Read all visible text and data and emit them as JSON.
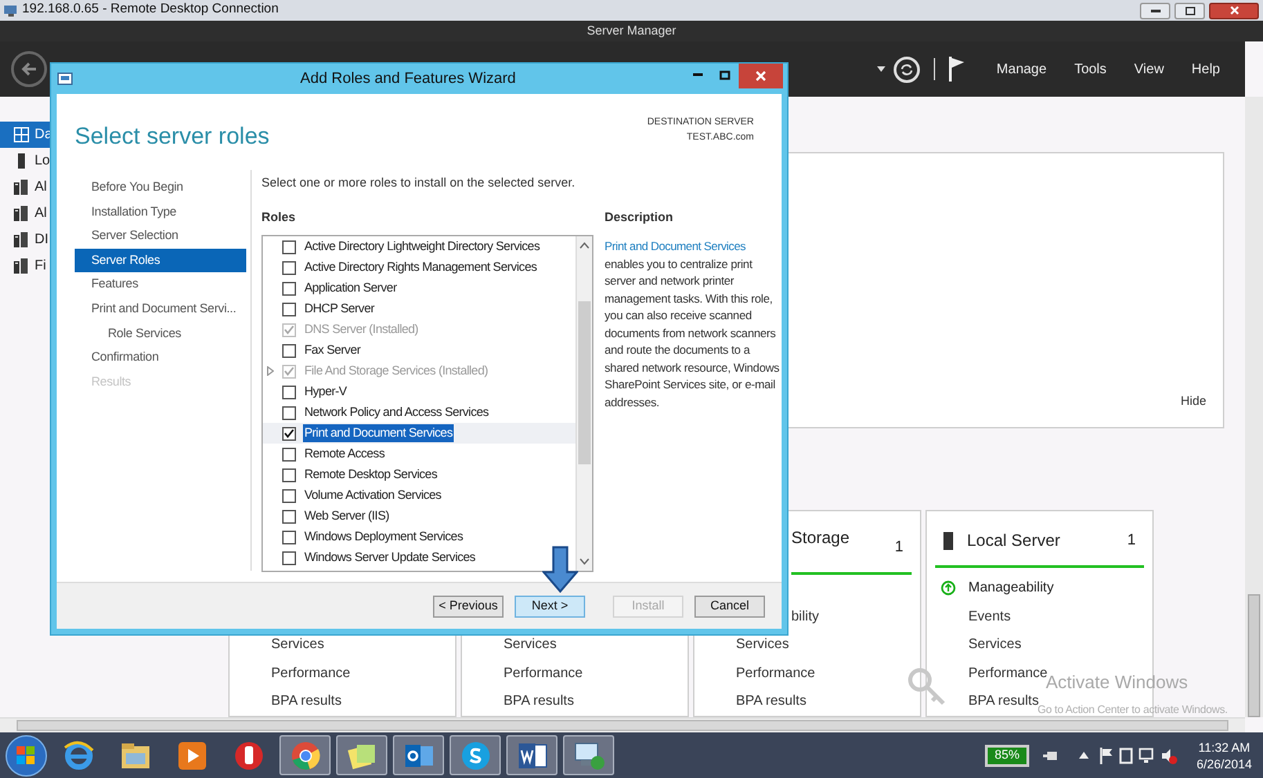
{
  "remote_desktop": {
    "title": "192.168.0.65 - Remote Desktop Connection"
  },
  "server_manager": {
    "title": "Server Manager",
    "menu": [
      "Manage",
      "Tools",
      "View",
      "Help"
    ],
    "sidebar": [
      {
        "label": "Da",
        "selected": true
      },
      {
        "label": "Lo",
        "selected": false
      },
      {
        "label": "Al",
        "selected": false
      },
      {
        "label": "Al",
        "selected": false
      },
      {
        "label": "DI",
        "selected": false
      },
      {
        "label": "Fi",
        "selected": false
      }
    ],
    "welcome_panel": {
      "hide_link": "Hide"
    },
    "tiles": [
      {
        "items": [
          {
            "label": "Services",
            "ok": false
          },
          {
            "label": "Performance",
            "ok": false
          },
          {
            "label": "BPA results",
            "ok": false
          }
        ]
      },
      {
        "items": [
          {
            "label": "Services",
            "ok": false
          },
          {
            "label": "Performance",
            "ok": false
          },
          {
            "label": "BPA results",
            "ok": false
          }
        ]
      },
      {
        "title": "Storage",
        "count": "1",
        "covered": true,
        "items": [
          {
            "label": "bility",
            "ok": false
          },
          {
            "label": "Services",
            "ok": false
          },
          {
            "label": "Performance",
            "ok": false
          },
          {
            "label": "BPA results",
            "ok": false
          }
        ]
      },
      {
        "title": "Local Server",
        "count": "1",
        "covered": false,
        "items": [
          {
            "label": "Manageability",
            "ok": true
          },
          {
            "label": "Events",
            "ok": false
          },
          {
            "label": "Services",
            "ok": false
          },
          {
            "label": "Performance",
            "ok": false
          },
          {
            "label": "BPA results",
            "ok": false
          }
        ]
      }
    ],
    "activation_notice": {
      "title": "Activate Windows",
      "text": "Go to Action Center to activate Windows."
    }
  },
  "wizard": {
    "title": "Add Roles and Features Wizard",
    "heading": "Select server roles",
    "destination_label": "DESTINATION SERVER",
    "destination": "TEST.ABC.com",
    "steps": [
      {
        "label": "Before You Begin",
        "selected": false,
        "disabled": false
      },
      {
        "label": "Installation Type",
        "selected": false,
        "disabled": false
      },
      {
        "label": "Server Selection",
        "selected": false,
        "disabled": false
      },
      {
        "label": "Server Roles",
        "selected": true,
        "disabled": false
      },
      {
        "label": "Features",
        "selected": false,
        "disabled": false
      },
      {
        "label": "Print and Document Servi...",
        "selected": false,
        "disabled": false,
        "children": [
          {
            "label": "Role Services",
            "selected": false,
            "disabled": false
          }
        ]
      },
      {
        "label": "Confirmation",
        "selected": false,
        "disabled": false
      },
      {
        "label": "Results",
        "selected": false,
        "disabled": true
      }
    ],
    "instruction": "Select one or more roles to install on the selected server.",
    "roles_heading": "Roles",
    "roles": [
      {
        "label": "Active Directory Lightweight Directory Services",
        "checked": false,
        "disabled": false,
        "expandable": false,
        "selected": false
      },
      {
        "label": "Active Directory Rights Management Services",
        "checked": false,
        "disabled": false,
        "expandable": false,
        "selected": false
      },
      {
        "label": "Application Server",
        "checked": false,
        "disabled": false,
        "expandable": false,
        "selected": false
      },
      {
        "label": "DHCP Server",
        "checked": false,
        "disabled": false,
        "expandable": false,
        "selected": false
      },
      {
        "label": "DNS Server (Installed)",
        "checked": true,
        "disabled": true,
        "expandable": false,
        "selected": false
      },
      {
        "label": "Fax Server",
        "checked": false,
        "disabled": false,
        "expandable": false,
        "selected": false
      },
      {
        "label": "File And Storage Services (Installed)",
        "checked": true,
        "disabled": true,
        "expandable": true,
        "selected": false
      },
      {
        "label": "Hyper-V",
        "checked": false,
        "disabled": false,
        "expandable": false,
        "selected": false
      },
      {
        "label": "Network Policy and Access Services",
        "checked": false,
        "disabled": false,
        "expandable": false,
        "selected": false
      },
      {
        "label": "Print and Document Services",
        "checked": true,
        "disabled": false,
        "expandable": false,
        "selected": true
      },
      {
        "label": "Remote Access",
        "checked": false,
        "disabled": false,
        "expandable": false,
        "selected": false
      },
      {
        "label": "Remote Desktop Services",
        "checked": false,
        "disabled": false,
        "expandable": false,
        "selected": false
      },
      {
        "label": "Volume Activation Services",
        "checked": false,
        "disabled": false,
        "expandable": false,
        "selected": false
      },
      {
        "label": "Web Server (IIS)",
        "checked": false,
        "disabled": false,
        "expandable": false,
        "selected": false
      },
      {
        "label": "Windows Deployment Services",
        "checked": false,
        "disabled": false,
        "expandable": false,
        "selected": false
      },
      {
        "label": "Windows Server Update Services",
        "checked": false,
        "disabled": false,
        "expandable": false,
        "selected": false
      }
    ],
    "description_heading": "Description",
    "description_link": "Print and Document Services",
    "description": "enables you to centralize print server and network printer management tasks. With this role, you can also receive scanned documents from network scanners and route the documents to a shared network resource, Windows SharePoint Services site, or e-mail addresses.",
    "buttons": [
      {
        "label": "< Previous",
        "default": false,
        "disabled": false
      },
      {
        "label": "Next >",
        "default": true,
        "disabled": false
      },
      {
        "label": "Install",
        "default": false,
        "disabled": true
      },
      {
        "label": "Cancel",
        "default": false,
        "disabled": false
      }
    ]
  },
  "taskbar": {
    "apps": [
      {
        "running": false
      },
      {
        "running": false
      },
      {
        "running": false
      },
      {
        "running": false
      },
      {
        "running": true
      },
      {
        "running": true
      },
      {
        "running": true
      },
      {
        "running": true
      },
      {
        "running": true
      },
      {
        "running": true
      }
    ],
    "battery": "85%",
    "time": "11:32 AM",
    "date": "6/26/2014"
  }
}
